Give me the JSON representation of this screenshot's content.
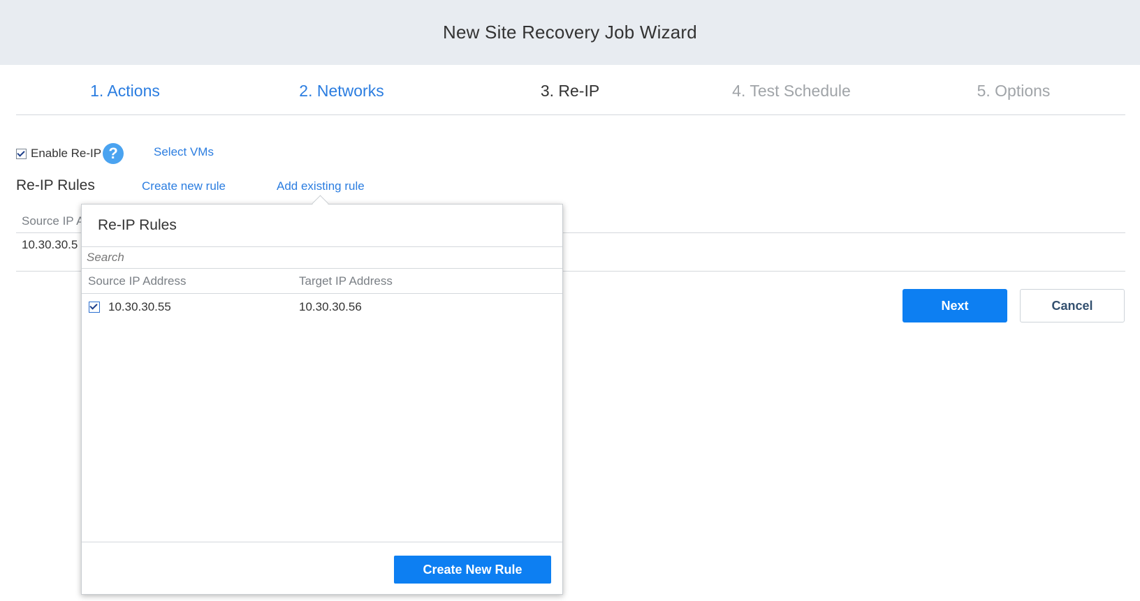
{
  "wizard": {
    "title": "New Site Recovery Job Wizard"
  },
  "steps": [
    {
      "label": "1. Actions",
      "state": "done"
    },
    {
      "label": "2. Networks",
      "state": "done"
    },
    {
      "label": "3. Re-IP",
      "state": "current"
    },
    {
      "label": "4. Test Schedule",
      "state": "future"
    },
    {
      "label": "5. Options",
      "state": "future"
    }
  ],
  "reip": {
    "enable_label": "Enable Re-IP",
    "enable_checked": true,
    "help_icon": "question-circle-icon",
    "select_vms_label": "Select VMs",
    "rules_title": "Re-IP Rules",
    "create_rule_link": "Create new rule",
    "add_existing_link": "Add existing rule",
    "table": {
      "col_source": "Source IP A",
      "row_source": "10.30.30.5"
    }
  },
  "buttons": {
    "next": "Next",
    "cancel": "Cancel"
  },
  "popover": {
    "title": "Re-IP Rules",
    "search_placeholder": "Search",
    "col_source": "Source IP Address",
    "col_target": "Target IP Address",
    "rows": [
      {
        "checked": true,
        "source": "10.30.30.55",
        "target": "10.30.30.56"
      }
    ],
    "create_button": "Create New Rule"
  },
  "colors": {
    "accent": "#0d7ff2",
    "link": "#2b7de0",
    "header_bg": "#e8ecf1"
  }
}
